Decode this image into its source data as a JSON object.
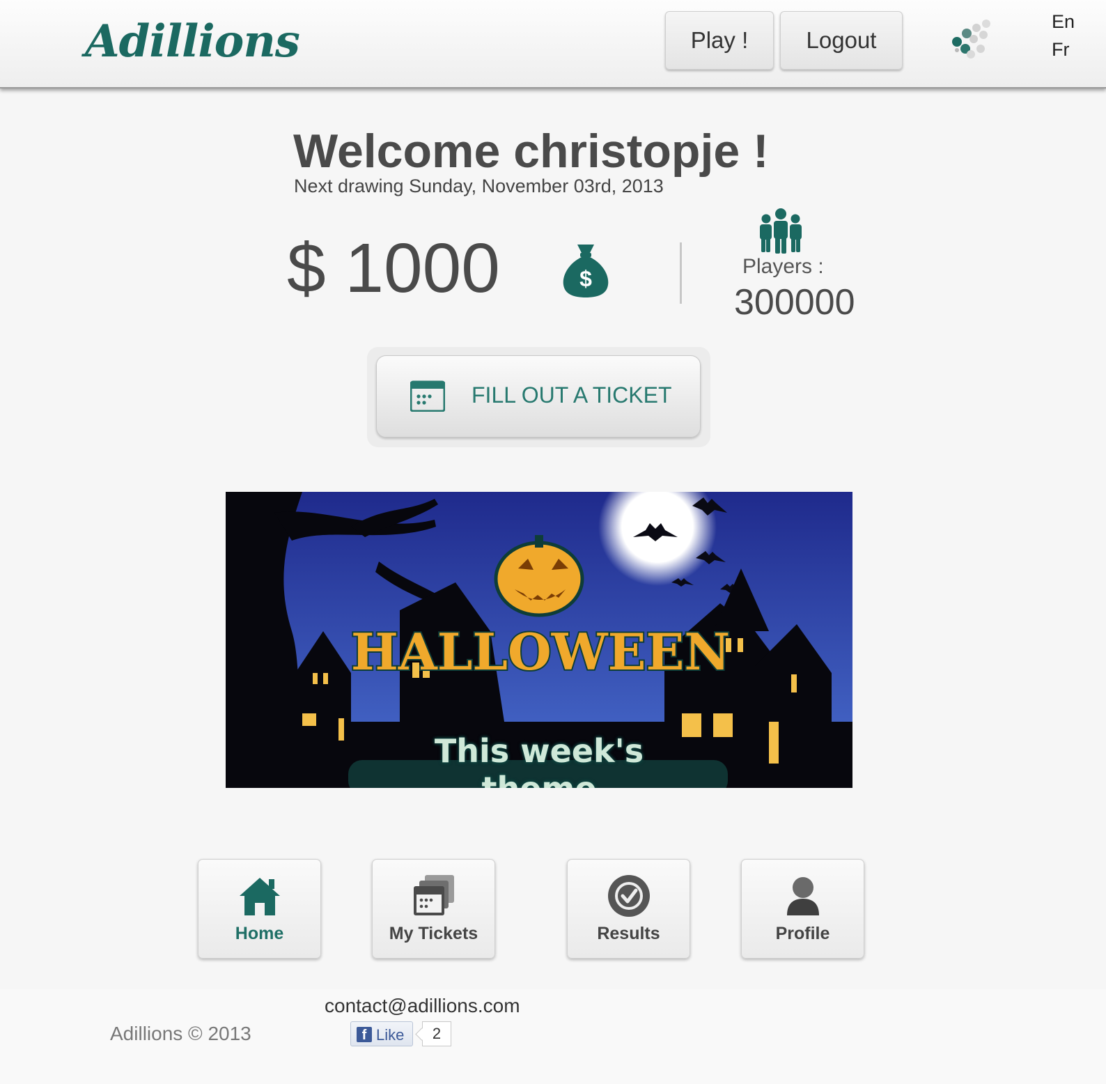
{
  "header": {
    "logo": "Adillions",
    "play_label": "Play !",
    "logout_label": "Logout",
    "languages": [
      "En",
      "Fr"
    ]
  },
  "welcome": {
    "title": "Welcome christopje !",
    "next_drawing": "Next drawing Sunday, November 03rd, 2013"
  },
  "stats": {
    "jackpot": "$ 1000",
    "players_label": "Players :",
    "players_count": "300000"
  },
  "cta": {
    "fill_ticket_label": "FILL OUT A TICKET"
  },
  "banner": {
    "title": "HALLOWEEN",
    "caption": "This week's theme"
  },
  "nav": {
    "items": [
      {
        "label": "Home",
        "icon": "home-icon",
        "active": true
      },
      {
        "label": "My Tickets",
        "icon": "tickets-icon",
        "active": false
      },
      {
        "label": "Results",
        "icon": "check-circle-icon",
        "active": false
      },
      {
        "label": "Profile",
        "icon": "user-icon",
        "active": false
      }
    ]
  },
  "footer": {
    "copyright": "Adillions © 2013",
    "contact": "contact@adillions.com",
    "like_label": "Like",
    "like_count": "2"
  },
  "colors": {
    "brand": "#1b6961",
    "accent_text": "#27796f",
    "banner_sky": "#2b3ba0",
    "pumpkin": "#f0a92c"
  }
}
